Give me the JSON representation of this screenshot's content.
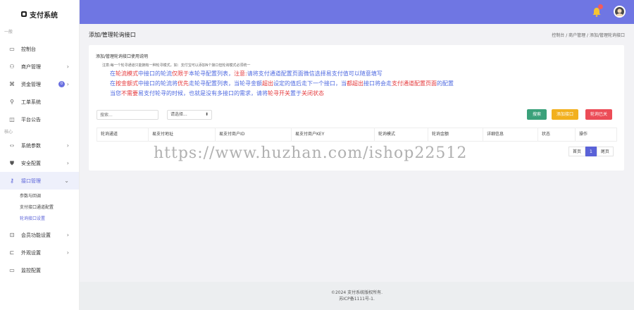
{
  "brand": "支付系统",
  "sidebar": {
    "group1": "一般",
    "group2": "核心",
    "items": [
      {
        "label": "控制台",
        "arrow": ""
      },
      {
        "label": "商户管理",
        "arrow": "›"
      },
      {
        "label": "资金管理",
        "arrow": "›",
        "badge": "0"
      },
      {
        "label": "工单系统",
        "arrow": ""
      },
      {
        "label": "平台公告",
        "arrow": ""
      },
      {
        "label": "系统参数",
        "arrow": "›"
      },
      {
        "label": "安全配置",
        "arrow": "›"
      },
      {
        "label": "接口管理",
        "arrow": "⌄"
      },
      {
        "label": "会员功能设置",
        "arrow": "›"
      },
      {
        "label": "外观设置",
        "arrow": "›"
      },
      {
        "label": "监控配置",
        "arrow": ""
      }
    ],
    "sub_items": [
      "参数与回调",
      "支付接口通道配置",
      "轮询接口设置"
    ]
  },
  "header": {
    "title": "添加/管理轮询接口",
    "breadcrumb": "控制台 / 商户管理 / 添加/管理轮询接口"
  },
  "card": {
    "title": "添加/管理轮询接口使用说明",
    "note": "注意:每一个轮寻通道只能拥有一种轮寻模式，如：支付宝可以添加N个接口但轮询模式必须统一",
    "line1": {
      "a": "在",
      "b": "轮流模式",
      "c": "中接口的轮流",
      "d": "仅限于",
      "e": "本轮寻配置列表，",
      "f": "注意:",
      "g": "请将支付通道配置页面微信选择易支付值可以随意填写"
    },
    "line2": {
      "a": "在",
      "b": "按金额式",
      "c": "中接口的轮流将",
      "d": "优先",
      "e": "走轮寻配置列表，当轮寻金额",
      "f": "超出",
      "g": "设定的值后走下一个接口，当",
      "h": "都超出",
      "i": "接口将会走",
      "j": "支付通道配置页面",
      "k": "的配置"
    },
    "line3": {
      "a": "当您",
      "b": "不需要",
      "c": "易支付轮寻的时候，也就是没有多接口的需求，请将",
      "d": "轮寻开关",
      "e": "置于",
      "f": "关闭状态"
    }
  },
  "toolbar": {
    "search_placeholder": "搜索...",
    "select_value": "请选择...",
    "search_btn": "搜索",
    "add_btn": "添加接口",
    "del_btn": "轮询已关"
  },
  "table": {
    "columns": [
      "轮询通道",
      "易支付地址",
      "易支付商户ID",
      "易支付商户KEY",
      "轮询模式",
      "轮询金额",
      "详细信息",
      "状态",
      "操作"
    ]
  },
  "pager": {
    "first": "首页",
    "current": "1",
    "last": "尾页"
  },
  "watermark": "https://www.huzhan.com/ishop22512",
  "footer": {
    "line1": "©2024 支付系统版权所有.",
    "line2": "苏ICP备1111号-1."
  },
  "colors": {
    "accent": "#6f76e3",
    "search": "#3aa17a",
    "add": "#f2b01e",
    "danger": "#ec4c57"
  }
}
